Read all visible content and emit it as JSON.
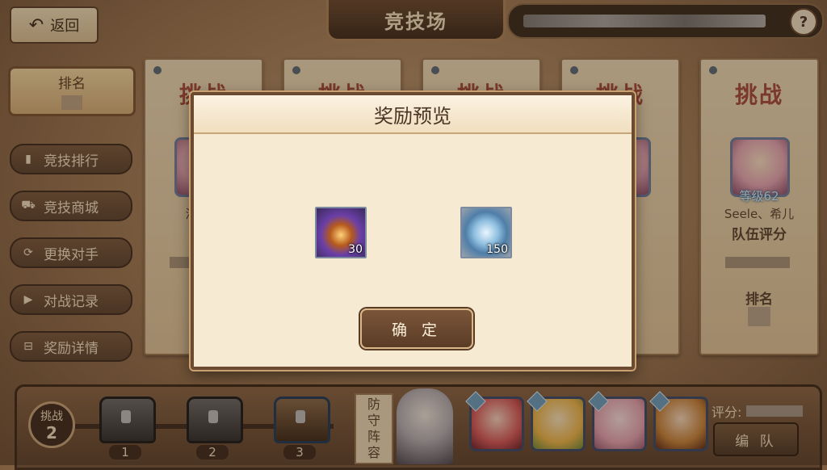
{
  "header": {
    "back_label": "返回",
    "title": "竞技场",
    "help_label": "?"
  },
  "side": {
    "rank_label": "排名",
    "menu": [
      {
        "label": "竞技排行",
        "icon": "bar-chart-icon"
      },
      {
        "label": "竞技商城",
        "icon": "cart-icon"
      },
      {
        "label": "更换对手",
        "icon": "refresh-icon"
      },
      {
        "label": "对战记录",
        "icon": "play-icon"
      },
      {
        "label": "奖励详情",
        "icon": "gift-icon"
      }
    ]
  },
  "cards": [
    {
      "head": "挑战",
      "level": "等",
      "name": "滔滔不",
      "score_label": "队伍"
    },
    {
      "head": "挑战"
    },
    {
      "head": "挑战"
    },
    {
      "head": "挑战",
      "level": "3",
      "score_label": "分"
    },
    {
      "head": "挑战",
      "level": "等级62",
      "name": "Seele、希儿",
      "score_label": "队伍评分",
      "rank_label": "排名"
    }
  ],
  "bottom": {
    "challenge_label": "挑战",
    "challenge_count": "2",
    "chest_numbers": [
      "1",
      "2",
      "3"
    ],
    "defense_label": [
      "防",
      "守",
      "阵",
      "容"
    ],
    "score_label": "评分:",
    "team_button": "编 队"
  },
  "modal": {
    "title": "奖励预览",
    "rewards": [
      {
        "icon": "purple-crystal-icon",
        "qty": "30"
      },
      {
        "icon": "silver-coin-icon",
        "qty": "150"
      }
    ],
    "confirm_label": "确 定"
  }
}
